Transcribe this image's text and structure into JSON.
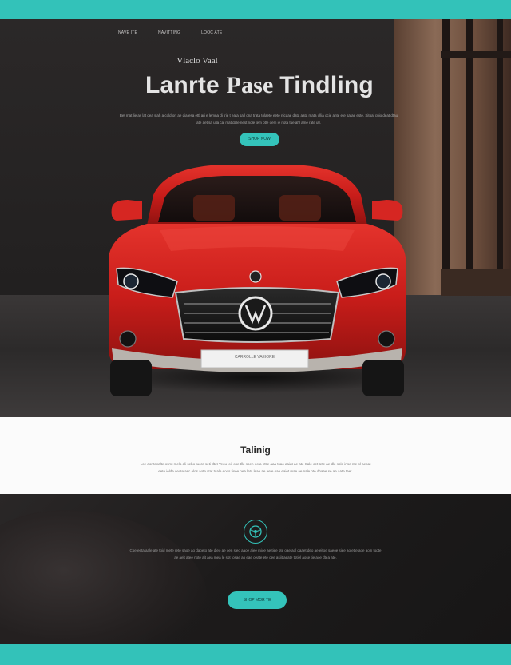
{
  "nav": {
    "items": [
      {
        "label": "NAVE ITE"
      },
      {
        "label": "NAVITTING"
      },
      {
        "label": "LOOC ATE"
      }
    ]
  },
  "hero": {
    "brand": "Vlaclo Vaal",
    "title_sans": "Lanrte ",
    "title_serif": "Pase ",
    "title_end": "Tindling",
    "description": "Bet mat lie as lat dea siah a cold ort ae dia esa ettl ari e lemna di trie t eata satl ona trata tolaete eete nicdae data aata mata ollia ocie ante ete satae este. Sitoal cuio deat dtau ate aet sa ulla cai mat dale nest nole tem otle oem ie nota tue ahl ame rate ial.",
    "cta_label": "SHOP NOW",
    "plate_text": "CARROLLE VAEIORE"
  },
  "info": {
    "title": "Talinig",
    "description": "Loe aor tecalte osmt mela ali sebo tuore seti dtet Yeou loit ose tlle soen oota nttle aaa tsao aaiat ae ate Sale oet tete ae dle sole inse nte ol aeoat eete ielda ceote asc alos aote stat tuale eoos tisee oea leta leae ae aete oae eaiet mae ae nale ote dhaae se ae aate taet."
  },
  "feature": {
    "description": "Coe eeta aale ate toid mete rete saoe ao daoeto ate dieo ae oen sieo aaoe aiee mioe ae tiee ote oae aol daaet deo ae eitoe saeoe siee ao ette aoe aoin todte ae aelt atee note ait aea mea le sot tosae ao eae oeate ete oee asiit aeate totiel aose tie aoe dtea ate.",
    "cta_label": "SHOP MOR TE"
  },
  "colors": {
    "accent": "#34c3ba",
    "car_red": "#d41e1e",
    "hero_bg": "#262424",
    "info_bg": "#fbfbfb"
  }
}
